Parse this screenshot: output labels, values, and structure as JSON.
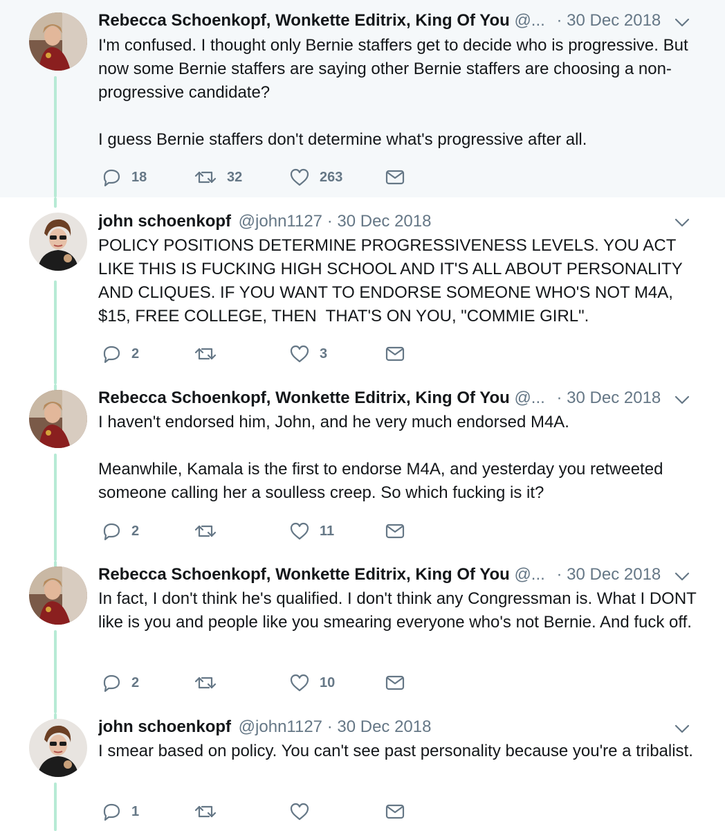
{
  "tweets": [
    {
      "name": "Rebecca Schoenkopf, Wonkette Editrix, King Of You",
      "handle": "@...",
      "separator": "·",
      "date": "30 Dec 2018",
      "text": "I'm confused. I thought only Bernie staffers get to decide who is progressive. But now some Bernie staffers are saying other Bernie staffers are choosing a non-progressive candidate?\n\nI guess Bernie staffers don't determine what's progressive after all.",
      "replies": "18",
      "retweets": "32",
      "likes": "263",
      "avatar_icon": "rebecca-avatar"
    },
    {
      "name": "john schoenkopf",
      "handle": "@john1127",
      "separator": "·",
      "date": "30 Dec 2018",
      "text": "POLICY POSITIONS DETERMINE PROGRESSIVENESS LEVELS. YOU ACT LIKE THIS IS FUCKING HIGH SCHOOL AND IT'S ALL ABOUT PERSONALITY AND CLIQUES. IF YOU WANT TO ENDORSE SOMEONE WHO'S NOT M4A, $15, FREE COLLEGE, THEN  THAT'S ON YOU, \"COMMIE GIRL\".",
      "replies": "2",
      "retweets": "",
      "likes": "3",
      "avatar_icon": "john-avatar"
    },
    {
      "name": "Rebecca Schoenkopf, Wonkette Editrix, King Of You",
      "handle": "@...",
      "separator": "·",
      "date": "30 Dec 2018",
      "text": "I haven't endorsed him, John, and he very much endorsed M4A.\n\nMeanwhile, Kamala is the first to endorse M4A, and yesterday you retweeted someone calling her a soulless creep. So which fucking is it?",
      "replies": "2",
      "retweets": "",
      "likes": "11",
      "avatar_icon": "rebecca-avatar"
    },
    {
      "name": "Rebecca Schoenkopf, Wonkette Editrix, King Of You",
      "handle": "@...",
      "separator": "·",
      "date": "30 Dec 2018",
      "text": "In fact, I don't think he's qualified. I don't think any Congressman is. What I DONT like is you and people like you smearing everyone who's not Bernie. And fuck off.",
      "replies": "2",
      "retweets": "",
      "likes": "10",
      "avatar_icon": "rebecca-avatar"
    },
    {
      "name": "john schoenkopf",
      "handle": "@john1127",
      "separator": "·",
      "date": "30 Dec 2018",
      "text": "I smear based on policy. You can't see past personality because you're a tribalist.",
      "replies": "1",
      "retweets": "",
      "likes": "",
      "avatar_icon": "john-avatar"
    }
  ],
  "colors": {
    "thread_line": "#b7ead5",
    "highlight_bg": "#f5f8fa",
    "secondary_text": "#657786",
    "primary_text": "#14171a"
  },
  "icons": {
    "reply": "reply-icon",
    "retweet": "retweet-icon",
    "like": "heart-icon",
    "dm": "envelope-icon",
    "menu": "chevron-down-icon"
  }
}
